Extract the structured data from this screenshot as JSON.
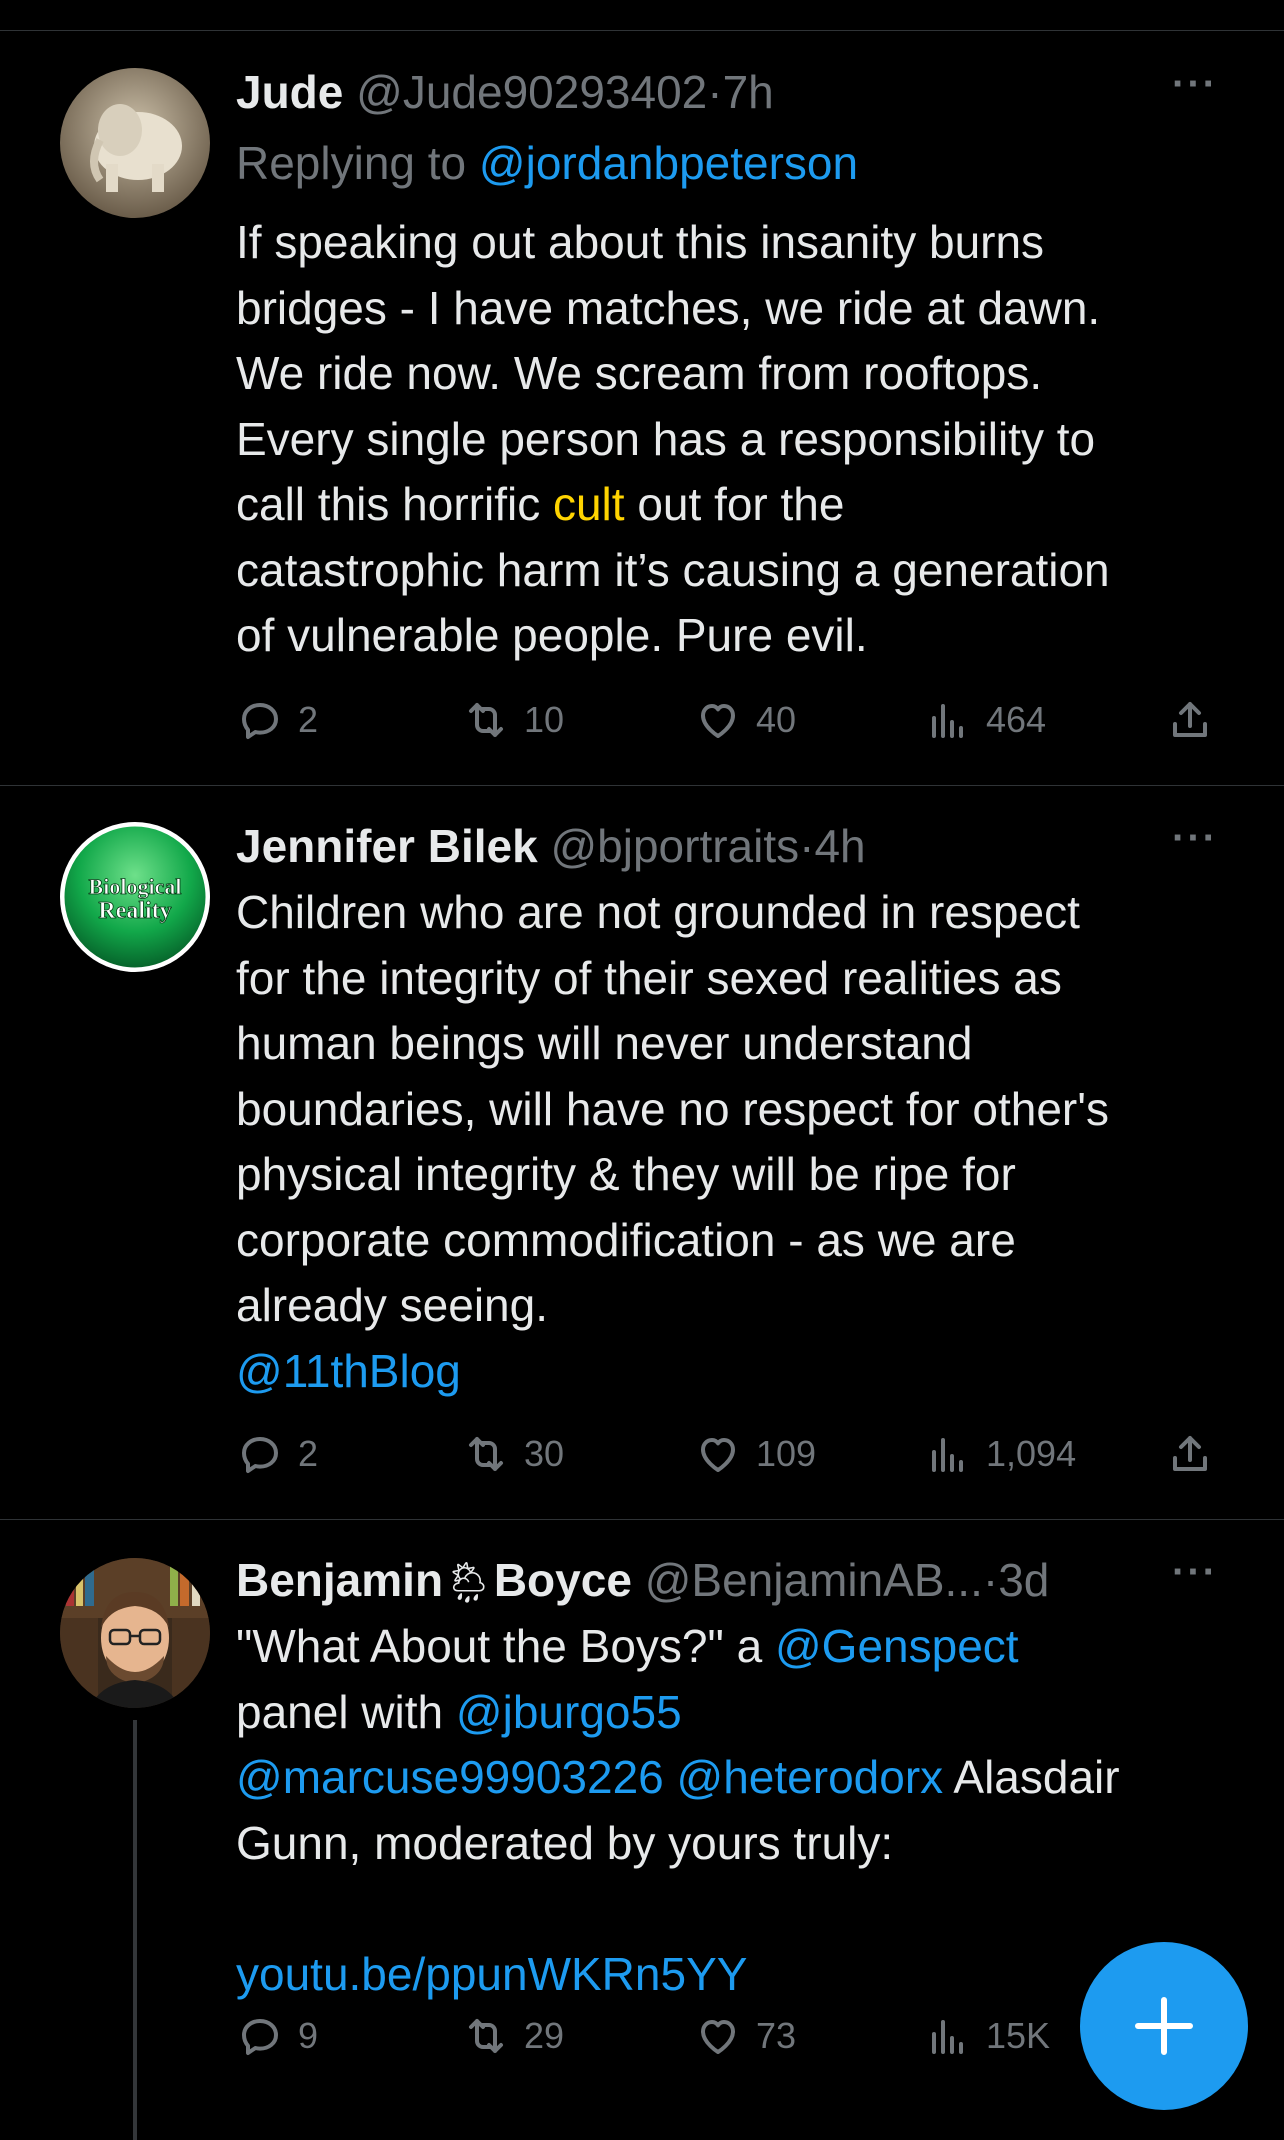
{
  "tweets": [
    {
      "name": "Jude",
      "handle": "@Jude90293402",
      "dot": "·",
      "time": "7h",
      "replying_prefix": "Replying to ",
      "replying_to": "@jordanbpeterson",
      "text_before": "If speaking out about this insanity burns\nbridges - I have matches, we ride at dawn.\nWe ride now. We scream from rooftops.\nEvery single person has a responsibility to\ncall this horrific ",
      "text_highlight": "cult",
      "text_after": " out for the\ncatastrophic harm it’s causing a generation\nof vulnerable people. Pure evil.",
      "replies": "2",
      "retweets": "10",
      "likes": "40",
      "views": "464"
    },
    {
      "name": "Jennifer Bilek",
      "handle": "@bjportraits",
      "dot": "·",
      "time": "4h",
      "avatar_text_1": "Biological",
      "avatar_text_2": "Reality",
      "text": "Children who are not grounded in respect\nfor the integrity of their sexed realities as\nhuman beings will never understand\nboundaries, will have no respect for other's\nphysical integrity & they will be ripe for\ncorporate commodification - as we are\nalready seeing.",
      "mention": "@11thBlog",
      "replies": "2",
      "retweets": "30",
      "likes": "109",
      "views": "1,094"
    },
    {
      "name_first": "Benjamin",
      "name_emoji": "🌦",
      "name_last": "Boyce",
      "handle": "@BenjaminAB...",
      "dot": "·",
      "time": "3d",
      "text_1": "\"What About the Boys?\" a ",
      "mention_1": "@Genspect",
      "text_2": "\npanel with ",
      "mention_2": "@jburgo55",
      "text_3": "\n",
      "mention_3": "@marcuse99903226",
      "text_4": " ",
      "mention_4": "@heterodorx",
      "text_5": " Alasdair\nGunn, moderated by yours truly:\n\n",
      "link": "youtu.be/ppunWKRn5YY",
      "replies": "9",
      "retweets": "29",
      "likes": "73",
      "views": "15K"
    }
  ],
  "more_label": "···",
  "colors": {
    "accent": "#1d9bf0",
    "muted": "#71767b",
    "highlight": "#ffd400"
  },
  "icons": [
    "reply-icon",
    "retweet-icon",
    "like-icon",
    "views-icon",
    "share-icon",
    "compose-plus-icon",
    "more-icon"
  ]
}
